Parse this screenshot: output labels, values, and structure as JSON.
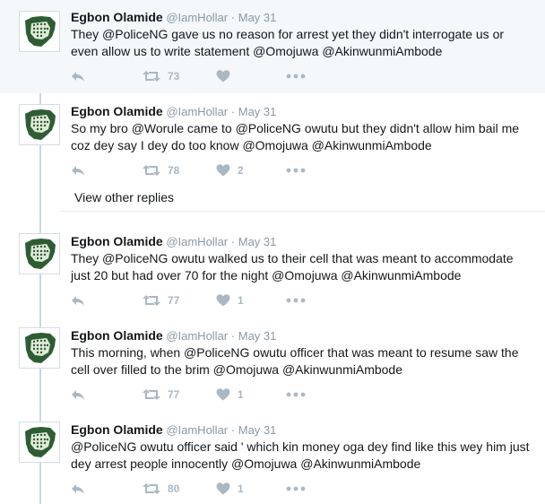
{
  "view_other_replies": "View other replies",
  "tweets": [
    {
      "name": "Egbon Olamide",
      "handle": "@IamHollar",
      "separator": "·",
      "time": "May 31",
      "text": "They @PoliceNG gave us no reason for arrest yet they didn't interrogate us or even allow us to write statement @Omojuwa @AkinwunmiAmbode",
      "retweets": "73",
      "likes": ""
    },
    {
      "name": "Egbon Olamide",
      "handle": "@IamHollar",
      "separator": "·",
      "time": "May 31",
      "text": "So my bro @Worule came to @PoliceNG owutu but they didn't allow him bail me coz dey say I dey do too know @Omojuwa @AkinwunmiAmbode",
      "retweets": "78",
      "likes": "2"
    },
    {
      "name": "Egbon Olamide",
      "handle": "@IamHollar",
      "separator": "·",
      "time": "May 31",
      "text": "They @PoliceNG owutu walked us to their cell that was meant to accommodate just 20 but had over 70 for the night  @Omojuwa @AkinwunmiAmbode",
      "retweets": "77",
      "likes": "1"
    },
    {
      "name": "Egbon Olamide",
      "handle": "@IamHollar",
      "separator": "·",
      "time": "May 31",
      "text": "This morning, when @PoliceNG owutu officer that was meant to resume saw the cell over filled to the brim @Omojuwa @AkinwunmiAmbode",
      "retweets": "77",
      "likes": "1"
    },
    {
      "name": "Egbon Olamide",
      "handle": "@IamHollar",
      "separator": "·",
      "time": "May 31",
      "text": "@PoliceNG owutu officer said ' which kin money oga dey find like this wey him just dey arrest people innocently @Omojuwa @AkinwunmiAmbode",
      "retweets": "80",
      "likes": "1"
    }
  ],
  "icons": {
    "reply": "reply-icon",
    "retweet": "retweet-icon",
    "like": "heart-icon",
    "more": "more-icon",
    "avatar": "nigeria-map-avatar"
  },
  "colors": {
    "avatar_green": "#2e5d34",
    "icon_grey": "#aab8c2",
    "highlight_bg": "#f5f8fa",
    "thread_line": "#ccd6dd"
  }
}
